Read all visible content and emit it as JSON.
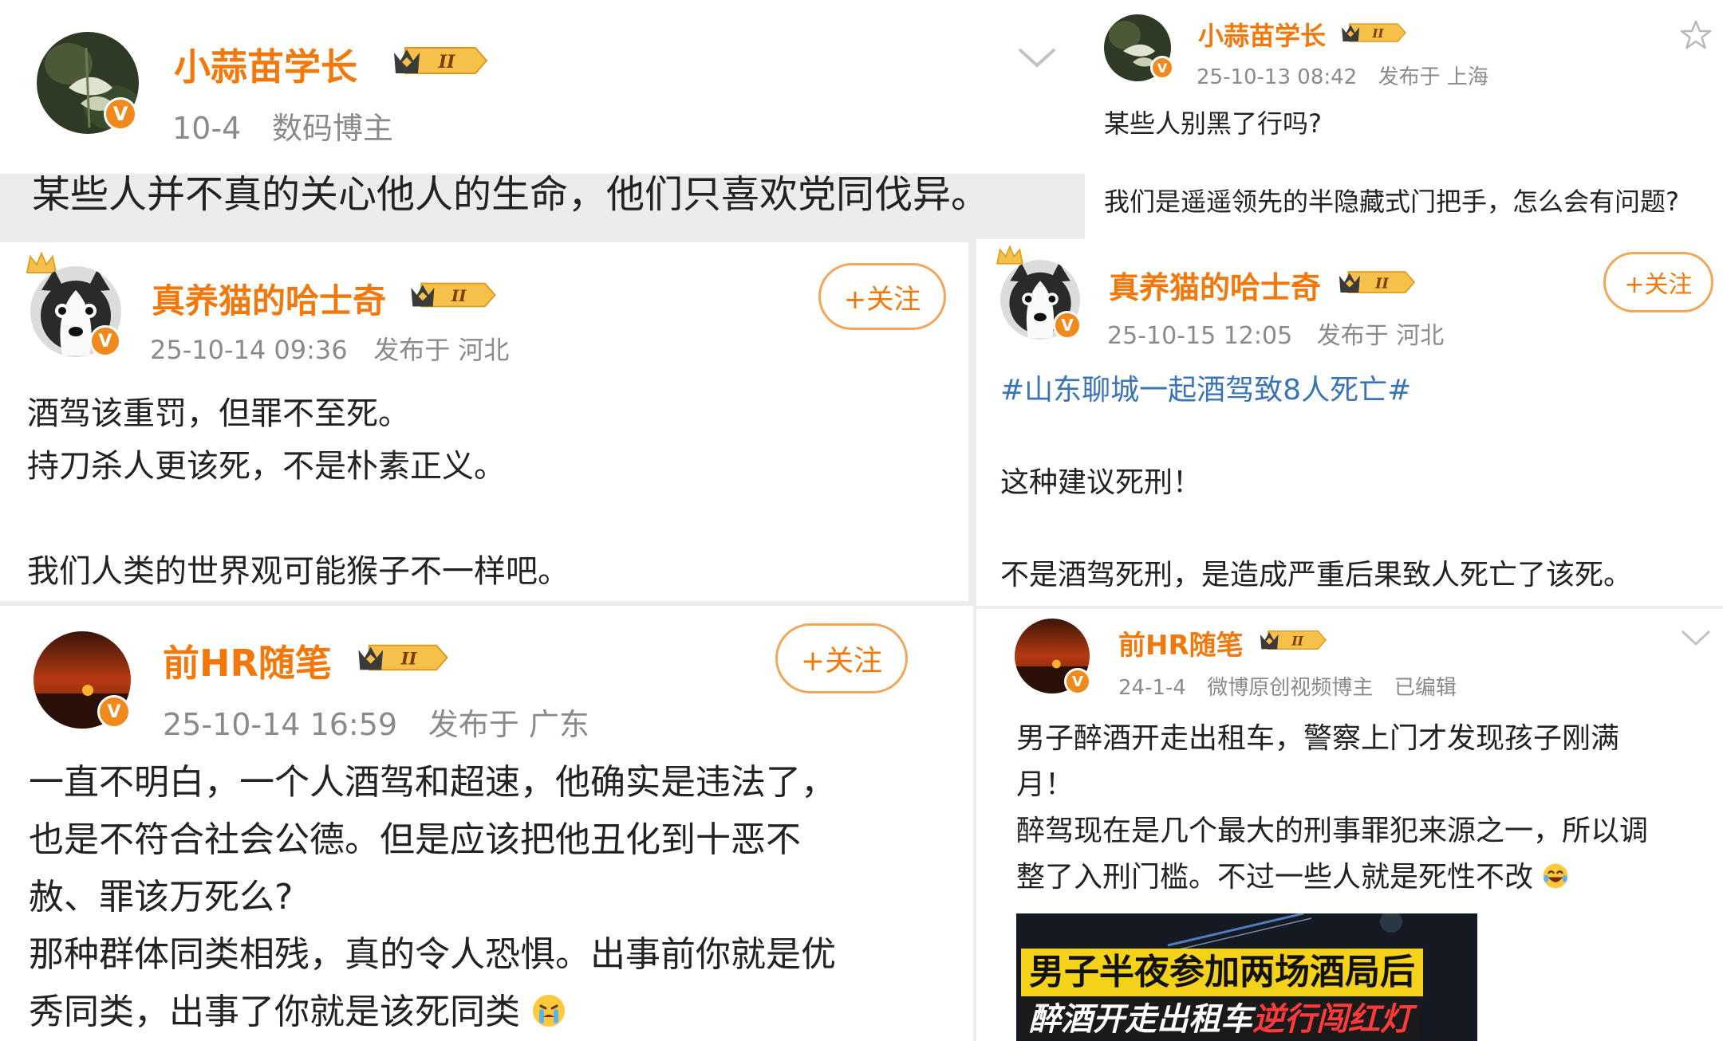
{
  "colors": {
    "username": "#f2780c",
    "topic": "#3a74b8",
    "meta": "#8a8a8a",
    "verified": "#f08a1c"
  },
  "icons": {
    "verified": "verified-v-icon",
    "level": "crown-level-badge-icon",
    "more": "chevron-down-icon",
    "favorite": "star-icon"
  },
  "posts": [
    {
      "username": "小蒜苗学长",
      "level": "II",
      "date": "10-4",
      "tag": "数码博主",
      "lines": [
        "某些人并不真的关心他人的生命，他们只喜欢党同伐异。"
      ]
    },
    {
      "username": "小蒜苗学长",
      "level": "II",
      "date": "25-10-13 08:42",
      "location": "发布于 上海",
      "lines": [
        "某些人别黑了行吗?",
        "我们是遥遥领先的半隐藏式门把手，怎么会有问题?"
      ]
    },
    {
      "username": "真养猫的哈士奇",
      "level": "II",
      "date": "25-10-14 09:36",
      "location": "发布于 河北",
      "follow_label": "+关注",
      "lines": [
        "酒驾该重罚，但罪不至死。",
        "持刀杀人更该死，不是朴素正义。",
        "我们人类的世界观可能猴子不一样吧。"
      ]
    },
    {
      "username": "真养猫的哈士奇",
      "level": "II",
      "date": "25-10-15 12:05",
      "location": "发布于 河北",
      "follow_label": "+关注",
      "topic": "#山东聊城一起酒驾致8人死亡#",
      "lines": [
        "这种建议死刑！",
        "不是酒驾死刑，是造成严重后果致人死亡了该死。"
      ]
    },
    {
      "username": "前HR随笔",
      "level": "II",
      "date": "25-10-14 16:59",
      "location": "发布于 广东",
      "follow_label": "+关注",
      "lines": [
        "一直不明白，一个人酒驾和超速，他确实是违法了，",
        "也是不符合社会公德。但是应该把他丑化到十恶不",
        "赦、罪该万死么?",
        "那种群体同类相残，真的令人恐惧。出事前你就是优",
        "秀同类，出事了你就是该死同类"
      ]
    },
    {
      "username": "前HR随笔",
      "level": "II",
      "date": "24-1-4",
      "tag": "微博原创视频博主",
      "edited": "已编辑",
      "lines": [
        "男子醉酒开走出租车，警察上门才发现孩子刚满",
        "月！",
        "醉驾现在是几个最大的刑事罪犯来源之一，所以调",
        "整了入刑门槛。不过一些人就是死性不改"
      ],
      "video_caption_1": "男子半夜参加两场酒局后",
      "video_caption_2a": "醉酒开走出租车",
      "video_caption_2b": "逆行闯红灯"
    }
  ]
}
